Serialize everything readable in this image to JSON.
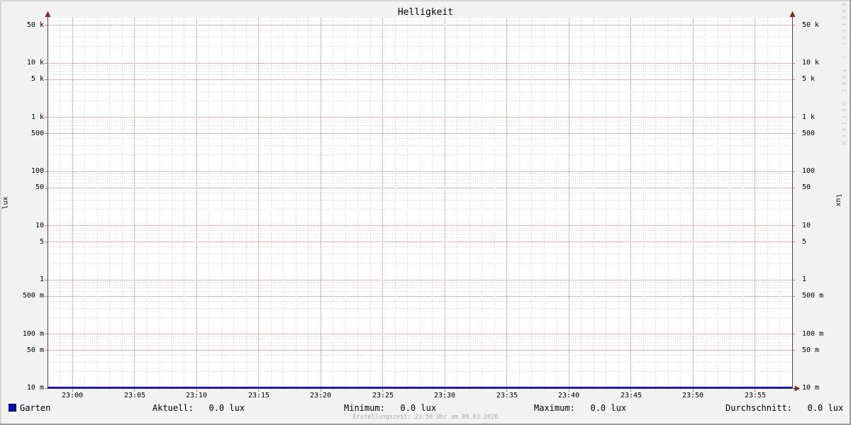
{
  "colors": {
    "background": "#f2f2f2",
    "canvas": "#ffffff",
    "grid_major": "#dc7a7a",
    "grid_minor": "#d2d2d2",
    "axis": "#4a4a4a",
    "arrow": "#8a2525",
    "series_blue": "#0000cc",
    "footer_text": "#a8a8a8",
    "watermark_text": "#c9c9c9",
    "bevel_light": "#d6d6d6",
    "bevel_dark": "#9b9b9b"
  },
  "chart_data": {
    "type": "line",
    "title": "Helligkeit",
    "ylabel_left": "lux",
    "ylabel_right": "lux",
    "y_scale": "log",
    "ylim": [
      0.01,
      70000
    ],
    "grid": "on",
    "legend_position": "bottom",
    "y_ticks": [
      {
        "v": 50000,
        "label": "50 k"
      },
      {
        "v": 10000,
        "label": "10 k"
      },
      {
        "v": 5000,
        "label": "5 k"
      },
      {
        "v": 1000,
        "label": "1 k"
      },
      {
        "v": 500,
        "label": "500"
      },
      {
        "v": 100,
        "label": "100"
      },
      {
        "v": 50,
        "label": "50"
      },
      {
        "v": 10,
        "label": "10"
      },
      {
        "v": 5,
        "label": "5"
      },
      {
        "v": 1,
        "label": "1"
      },
      {
        "v": 0.5,
        "label": "500 m"
      },
      {
        "v": 0.1,
        "label": "100 m"
      },
      {
        "v": 0.05,
        "label": "50 m"
      },
      {
        "v": 0.01,
        "label": "10 m"
      }
    ],
    "x_range": {
      "start": "22:58",
      "end": "23:58",
      "minutes": 60,
      "minor_step_min": 1,
      "major_step_min": 5
    },
    "x_ticks": [
      {
        "minute": 2,
        "label": "23:00"
      },
      {
        "minute": 7,
        "label": "23:05"
      },
      {
        "minute": 12,
        "label": "23:10"
      },
      {
        "minute": 17,
        "label": "23:15"
      },
      {
        "minute": 22,
        "label": "23:20"
      },
      {
        "minute": 27,
        "label": "23:25"
      },
      {
        "minute": 32,
        "label": "23:30"
      },
      {
        "minute": 37,
        "label": "23:35"
      },
      {
        "minute": 42,
        "label": "23:40"
      },
      {
        "minute": 47,
        "label": "23:45"
      },
      {
        "minute": 52,
        "label": "23:50"
      },
      {
        "minute": 57,
        "label": "23:55"
      }
    ],
    "series": [
      {
        "name": "Garten",
        "color": "#0000cc",
        "unit": "lux",
        "values": [
          0.0,
          0.0
        ],
        "aktuell": 0.0,
        "minimum": 0.0,
        "maximum": 0.0,
        "durchschnitt": 0.0
      }
    ]
  },
  "legend": {
    "series_name": "Garten",
    "stats": [
      {
        "name": "aktuell",
        "text": "Aktuell:   0.0 lux"
      },
      {
        "name": "minimum",
        "text": "Minimum:   0.0 lux"
      },
      {
        "name": "maximum",
        "text": "Maximum:   0.0 lux"
      },
      {
        "name": "durchschnitt",
        "text": "Durchschnitt:   0.0 lux"
      }
    ]
  },
  "footer": {
    "text": "Erstellungszeit: 23:58 Uhr am 09.03.2026"
  },
  "watermark": {
    "text": "RRDTOOL / TOBI OETIKER"
  }
}
